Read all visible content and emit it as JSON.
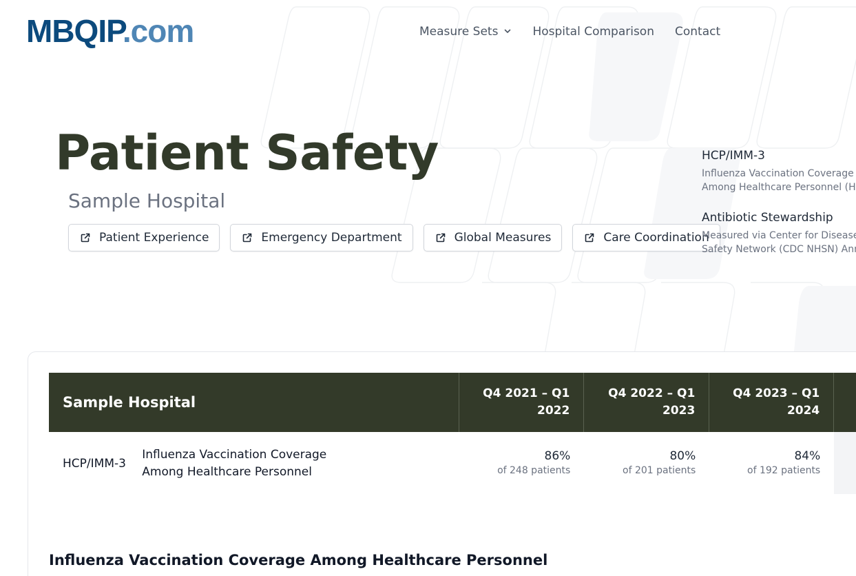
{
  "header": {
    "logo_brand": "MBQIP",
    "logo_tld": ".com",
    "nav": [
      {
        "label": "Measure Sets",
        "has_dropdown": true
      },
      {
        "label": "Hospital Comparison"
      },
      {
        "label": "Contact"
      }
    ]
  },
  "hero": {
    "title": "Patient Safety",
    "subtitle": "Sample Hospital",
    "links": [
      {
        "label": "Patient Experience",
        "icon": "external-link-icon"
      },
      {
        "label": "Emergency Department",
        "icon": "external-link-icon"
      },
      {
        "label": "Global Measures",
        "icon": "external-link-icon"
      },
      {
        "label": "Care Coordination",
        "icon": "external-link-icon"
      }
    ]
  },
  "side_measures": [
    {
      "title": "HCP/IMM-3",
      "desc_line1": "Influenza Vaccination Coverage",
      "desc_line2": "Among Healthcare Personnel (HCP"
    },
    {
      "title": "Antibiotic Stewardship",
      "desc_line1": "Measured via Center for Disease C",
      "desc_line2": "Safety Network (CDC NHSN) Annu"
    }
  ],
  "table": {
    "header": "Sample Hospital",
    "periods": [
      {
        "line1": "Q4 2021 – Q1",
        "line2": "2022"
      },
      {
        "line1": "Q4 2022 – Q1",
        "line2": "2023"
      },
      {
        "line1": "Q4 2023 – Q1",
        "line2": "2024"
      }
    ],
    "rows": [
      {
        "code": "HCP/IMM-3",
        "name_line1": "Influenza Vaccination Coverage",
        "name_line2": "Among Healthcare Personnel",
        "values": [
          {
            "pct": "86%",
            "count": "of 248 patients"
          },
          {
            "pct": "80%",
            "count": "of 201 patients"
          },
          {
            "pct": "84%",
            "count": "of 192 patients"
          }
        ]
      }
    ]
  },
  "section": {
    "title": "Influenza Vaccination Coverage Among Healthcare Personnel"
  },
  "colors": {
    "brand_dark": "#0c4a7d",
    "brand_light": "#4f86b5",
    "table_header_bg": "#333a29",
    "hero_title": "#323a2a"
  }
}
